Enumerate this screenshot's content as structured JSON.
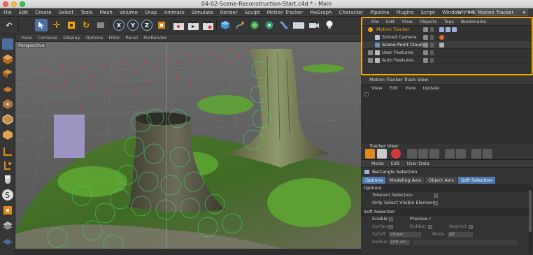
{
  "window": {
    "title": "04-02-Scene-Reconstruction-Start.c4d * - Main"
  },
  "menubar": {
    "items": [
      "File",
      "Edit",
      "Create",
      "Select",
      "Tools",
      "Mesh",
      "Volume",
      "Snap",
      "Animate",
      "Simulate",
      "Render",
      "Sculpt",
      "Motion Tracker",
      "MoGraph",
      "Character",
      "Pipeline",
      "Plugins",
      "Script",
      "Window",
      "Help"
    ],
    "layout_label": "Layout:",
    "layout_value": "Motion Tracker"
  },
  "toolbar": {
    "axis_x": "X",
    "axis_y": "Y",
    "axis_z": "Z"
  },
  "viewport": {
    "menu": [
      "View",
      "Cameras",
      "Display",
      "Options",
      "Filter",
      "Panel",
      "ProRender"
    ],
    "camera_label": "Perspective"
  },
  "object_manager": {
    "menu": [
      "File",
      "Edit",
      "View",
      "Objects",
      "Tags",
      "Bookmarks"
    ],
    "objects": [
      {
        "name": "Motion Tracker",
        "color": "#f0a020"
      },
      {
        "name": "Solved Camera",
        "color": "#cfcfcf"
      },
      {
        "name": "Scene Point Cloud",
        "color": "#e8e8e8"
      },
      {
        "name": "User Features",
        "color": "#cfcfcf"
      },
      {
        "name": "Auto Features",
        "color": "#cfcfcf"
      }
    ]
  },
  "track_view": {
    "title": "Motion Tracker Track View",
    "menu": [
      "View",
      "Edit",
      "View",
      "Update"
    ],
    "bar_label": "Tracker View"
  },
  "attributes": {
    "menu": [
      "Mode",
      "Edit",
      "User Data"
    ],
    "title": "Rectangle Selection",
    "tabs": [
      {
        "label": "Options",
        "on": true
      },
      {
        "label": "Modeling Axis",
        "on": false
      },
      {
        "label": "Object Axis",
        "on": false
      },
      {
        "label": "Soft Selection",
        "on": true
      }
    ],
    "section_options": "Options",
    "tolerant_selection": "Tolerant Selection",
    "only_visible": "Only Select Visible Elements",
    "section_soft": "Soft Selection",
    "enable": "Enable",
    "preview": "Preview",
    "surface": "Surface",
    "rubber": "Rubber",
    "restrict": "Restrict",
    "falloff": "Falloff",
    "falloff_value": "Linear",
    "mode": "Mode",
    "mode_value": "All",
    "radius": "Radius",
    "radius_value": "100 cm"
  },
  "colors": {
    "accent_orange": "#f2a900",
    "tab_blue": "#4f79b0",
    "grass": "#4a8a2c",
    "track_red": "#d23a3a"
  }
}
